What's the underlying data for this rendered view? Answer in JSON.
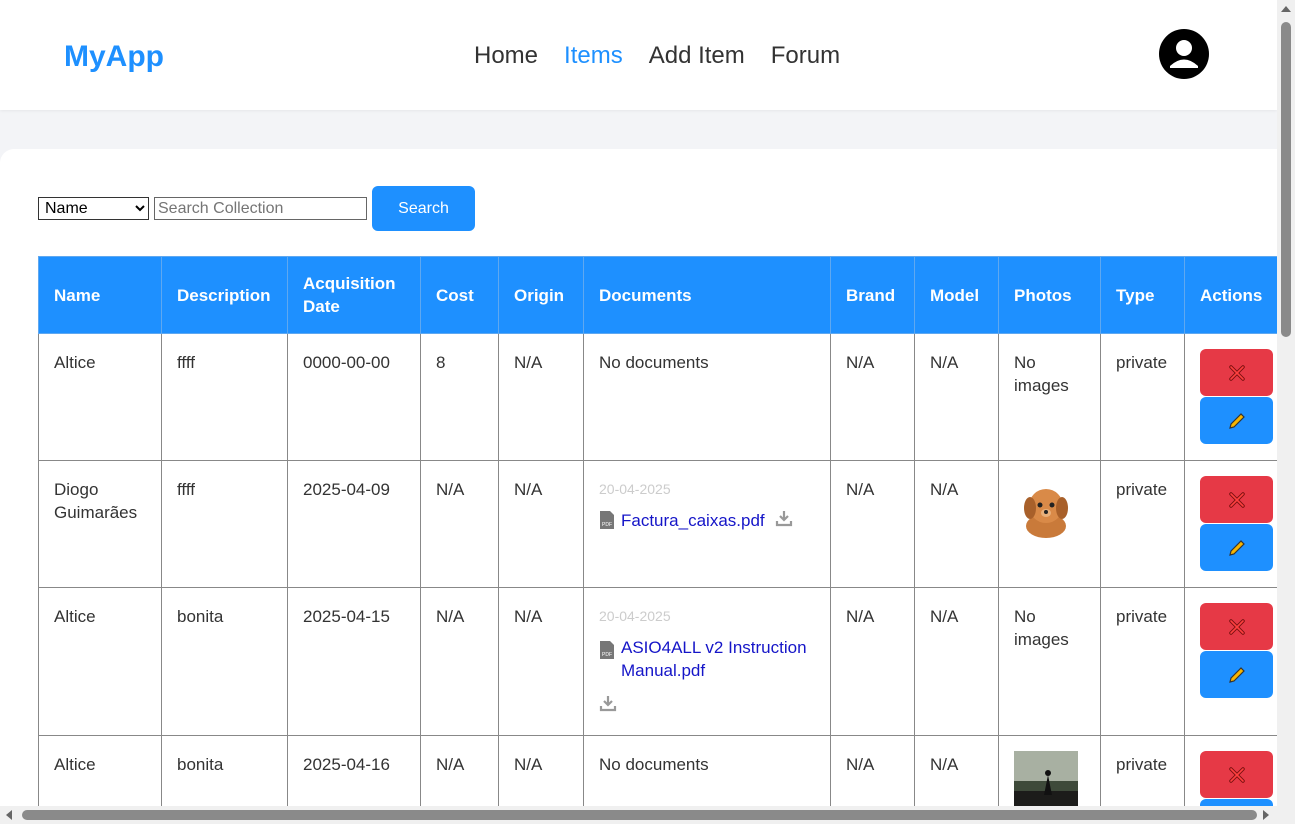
{
  "navbar": {
    "brand": "MyApp",
    "links": [
      {
        "label": "Home",
        "active": false
      },
      {
        "label": "Items",
        "active": true
      },
      {
        "label": "Add Item",
        "active": false
      },
      {
        "label": "Forum",
        "active": false
      }
    ],
    "avatar_icon": "user-circle-icon"
  },
  "search": {
    "select_value": "Name",
    "placeholder": "Search Collection",
    "button_label": "Search"
  },
  "table": {
    "headers": [
      "Name",
      "Description",
      "Acquisition Date",
      "Cost",
      "Origin",
      "Documents",
      "Brand",
      "Model",
      "Photos",
      "Type",
      "Actions"
    ],
    "rows": [
      {
        "name": "Altice",
        "description": "ffff",
        "date": "0000-00-00",
        "cost": "8",
        "origin": "N/A",
        "documents_text": "No documents",
        "brand": "N/A",
        "model": "N/A",
        "photos_text": "No images",
        "type": "private"
      },
      {
        "name": "Diogo Guimarães",
        "description": "ffff",
        "date": "2025-04-09",
        "cost": "N/A",
        "origin": "N/A",
        "doc_date": "20-04-2025",
        "doc_name": "Factura_caixas.pdf",
        "brand": "N/A",
        "model": "N/A",
        "photo": "puppy plush toy",
        "type": "private"
      },
      {
        "name": "Altice",
        "description": "bonita",
        "date": "2025-04-15",
        "cost": "N/A",
        "origin": "N/A",
        "doc_date": "20-04-2025",
        "doc_name": "ASIO4ALL v2 Instruction Manual.pdf",
        "brand": "N/A",
        "model": "N/A",
        "photos_text": "No images",
        "type": "private"
      },
      {
        "name": "Altice",
        "description": "bonita",
        "date": "2025-04-16",
        "cost": "N/A",
        "origin": "N/A",
        "documents_text": "No documents",
        "brand": "N/A",
        "model": "N/A",
        "photo": "dark game artwork",
        "type": "private"
      }
    ]
  },
  "colors": {
    "accent": "#1e90ff",
    "delete": "#e63946",
    "link": "#1515c8"
  }
}
